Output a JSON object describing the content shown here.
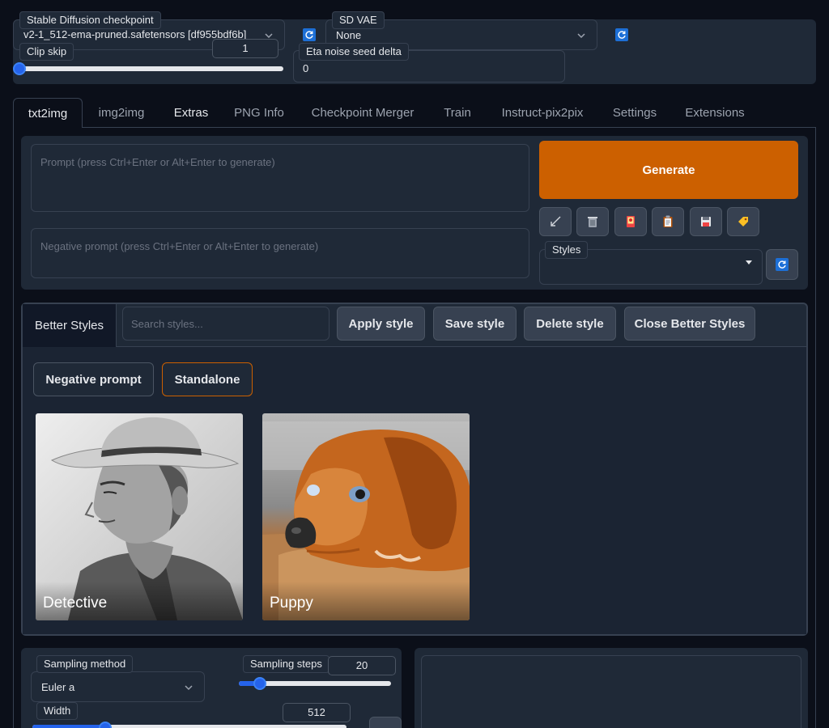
{
  "settings": {
    "checkpoint": {
      "label": "Stable Diffusion checkpoint",
      "value": "v2-1_512-ema-pruned.safetensors [df955bdf6b]"
    },
    "vae": {
      "label": "SD VAE",
      "value": "None"
    },
    "clip_skip": {
      "label": "Clip skip",
      "value": "1",
      "level": 0.0
    },
    "eta_noise": {
      "label": "Eta noise seed delta",
      "value": "0"
    }
  },
  "tabs": [
    {
      "label": "txt2img",
      "active": true
    },
    {
      "label": "img2img"
    },
    {
      "label": "Extras"
    },
    {
      "label": "PNG Info"
    },
    {
      "label": "Checkpoint Merger"
    },
    {
      "label": "Train"
    },
    {
      "label": "Instruct-pix2pix"
    },
    {
      "label": "Settings"
    },
    {
      "label": "Extensions"
    }
  ],
  "prompt": {
    "positive_placeholder": "Prompt (press Ctrl+Enter or Alt+Enter to generate)",
    "negative_placeholder": "Negative prompt (press Ctrl+Enter or Alt+Enter to generate)"
  },
  "generate_label": "Generate",
  "tool_icons": [
    "arrow-icon",
    "trash-icon",
    "card-icon",
    "clipboard-icon",
    "save-icon",
    "tag-icon"
  ],
  "styles": {
    "label": "Styles",
    "value": ""
  },
  "better_styles": {
    "tab_label": "Better Styles",
    "search_placeholder": "Search styles...",
    "apply": "Apply style",
    "save": "Save style",
    "delete": "Delete style",
    "close": "Close Better Styles",
    "filters": {
      "negative": "Negative prompt",
      "standalone": "Standalone"
    },
    "cards": [
      {
        "title": "Detective"
      },
      {
        "title": "Puppy"
      }
    ]
  },
  "sampling": {
    "method_label": "Sampling method",
    "method_value": "Euler a",
    "steps_label": "Sampling steps",
    "steps_value": "20",
    "steps_level": 0.13,
    "width_label": "Width",
    "width_value": "512",
    "width_level": 0.22
  },
  "colors": {
    "accent": "#cc6000",
    "page_bg": "#0b0f19",
    "panel_bg": "#1f2937",
    "slider": "#2563eb"
  }
}
